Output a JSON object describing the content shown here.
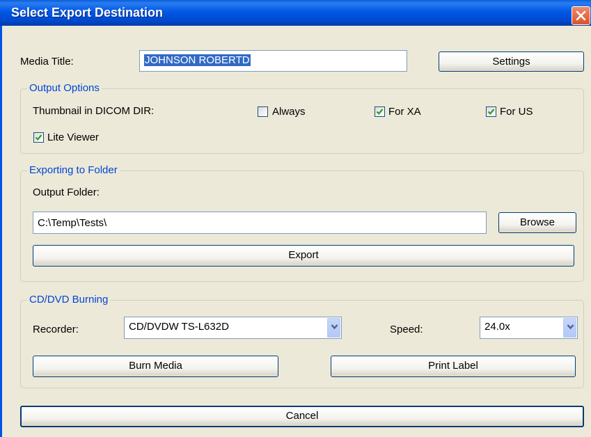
{
  "window": {
    "title": "Select Export Destination",
    "close_icon": "close-icon"
  },
  "media": {
    "label": "Media Title:",
    "value": "JOHNSON ROBERTD",
    "settings_label": "Settings"
  },
  "output_options": {
    "title": "Output Options",
    "thumbnail_label": "Thumbnail in DICOM DIR:",
    "always": {
      "label": "Always",
      "checked": false
    },
    "for_xa": {
      "label": "For XA",
      "checked": true
    },
    "for_us": {
      "label": "For US",
      "checked": true
    },
    "lite_viewer": {
      "label": "Lite Viewer",
      "checked": true
    }
  },
  "folder": {
    "title": "Exporting to Folder",
    "output_label": "Output Folder:",
    "path": "C:\\Temp\\Tests\\",
    "browse_label": "Browse",
    "export_label": "Export"
  },
  "burning": {
    "title": "CD/DVD Burning",
    "recorder_label": "Recorder:",
    "recorder_value": "CD/DVDW TS-L632D",
    "speed_label": "Speed:",
    "speed_value": "24.0x",
    "burn_label": "Burn Media",
    "print_label": "Print Label"
  },
  "footer": {
    "cancel_label": "Cancel"
  },
  "colors": {
    "title_bar": "#0058e6",
    "group_title": "#0046d5",
    "dialog_bg": "#ece9d8",
    "selection": "#316ac5"
  }
}
